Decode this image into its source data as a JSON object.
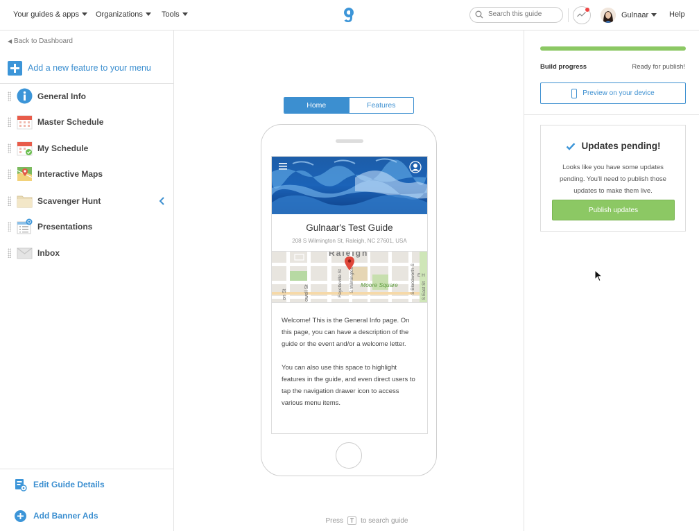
{
  "topnav": {
    "guides_apps": "Your guides & apps",
    "organizations": "Organizations",
    "tools": "Tools",
    "logo_icon": "guidebook-g-logo",
    "search_placeholder": "Search this guide",
    "user_name": "Gulnaar",
    "help": "Help"
  },
  "sidebar": {
    "back_link": "Back to Dashboard",
    "add_feature": "Add a new feature to your menu",
    "items": [
      {
        "label": "General Info",
        "icon": "info-icon"
      },
      {
        "label": "Master Schedule",
        "icon": "calendar-icon"
      },
      {
        "label": "My Schedule",
        "icon": "calendar-check-icon"
      },
      {
        "label": "Interactive Maps",
        "icon": "map-icon"
      },
      {
        "label": "Scavenger Hunt",
        "icon": "folder-icon"
      },
      {
        "label": "Presentations",
        "icon": "presentation-icon"
      },
      {
        "label": "Inbox",
        "icon": "envelope-icon"
      }
    ],
    "edit_guide": "Edit Guide Details",
    "add_banner": "Add Banner Ads"
  },
  "center": {
    "tabs": [
      "Home",
      "Features"
    ],
    "active_tab": "Home",
    "guide_title": "Gulnaar's Test Guide",
    "guide_address": "208 S Wilmington St, Raleigh, NC 27601, USA",
    "map_labels": {
      "city": "Raleigh",
      "park": "Moore Square",
      "streets": [
        "on St",
        "owell St",
        "Fayetteville St",
        "S Wilmington St",
        "S Bloodworth S",
        "S East St",
        "E H"
      ]
    },
    "welcome_p1": "Welcome! This is the General Info page. On this page, you can have a description of the guide or the event and/or a welcome letter.",
    "welcome_p2": "You can also use this space to highlight features in the guide, and even direct users to tap the navigation drawer icon to access various menu items.",
    "press_hint_prefix": "Press",
    "press_hint_key": "T",
    "press_hint_suffix": "to search guide"
  },
  "right": {
    "build_progress_label": "Build progress",
    "build_progress_status": "Ready for publish!",
    "build_progress_fraction": 1.0,
    "preview_button": "Preview on your device",
    "updates_title": "Updates pending!",
    "updates_body": "Looks like you have some updates pending. You'll need to publish those updates to make them live.",
    "publish_button": "Publish updates"
  },
  "colors": {
    "accent": "#3c8fd0",
    "success": "#8cc864"
  }
}
